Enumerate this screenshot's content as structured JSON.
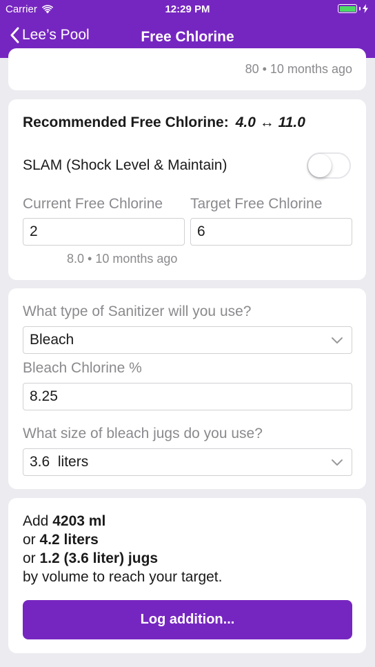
{
  "status_bar": {
    "carrier": "Carrier",
    "time": "12:29 PM"
  },
  "nav": {
    "back_label": "Lee’s Pool",
    "title": "Free Chlorine"
  },
  "previous_reading": {
    "meta": "80 • 10 months ago"
  },
  "chlorine": {
    "recommended_label": "Recommended Free Chlorine:",
    "recommended_range": "4.0 ↔ 11.0",
    "slam_label": "SLAM (Shock Level & Maintain)",
    "slam_on": false,
    "current_label": "Current Free Chlorine",
    "current_value": "2",
    "target_label": "Target Free Chlorine",
    "target_value": "6",
    "last_reading": "8.0 • 10 months ago"
  },
  "sanitizer": {
    "type_label": "What type of Sanitizer will you use?",
    "type_value": "Bleach",
    "percent_label": "Bleach Chlorine %",
    "percent_value": "8.25",
    "jug_label": "What size of bleach jugs do you use?",
    "jug_value": "3.6  liters"
  },
  "result": {
    "line1_prefix": "Add",
    "line1_value": "4203 ml",
    "line2_prefix": "or",
    "line2_value": "4.2 liters",
    "line3_prefix": "or",
    "line3_value": "1.2 (3.6 liter) jugs",
    "line4": "by volume to reach your target.",
    "button_label": "Log addition..."
  },
  "colors": {
    "accent": "#7626c0",
    "battery": "#4cd964",
    "muted": "#8a8a8e"
  },
  "icons": [
    "wifi-icon",
    "battery-icon",
    "charging-bolt-icon",
    "back-chevron-icon",
    "chevron-down-icon"
  ]
}
